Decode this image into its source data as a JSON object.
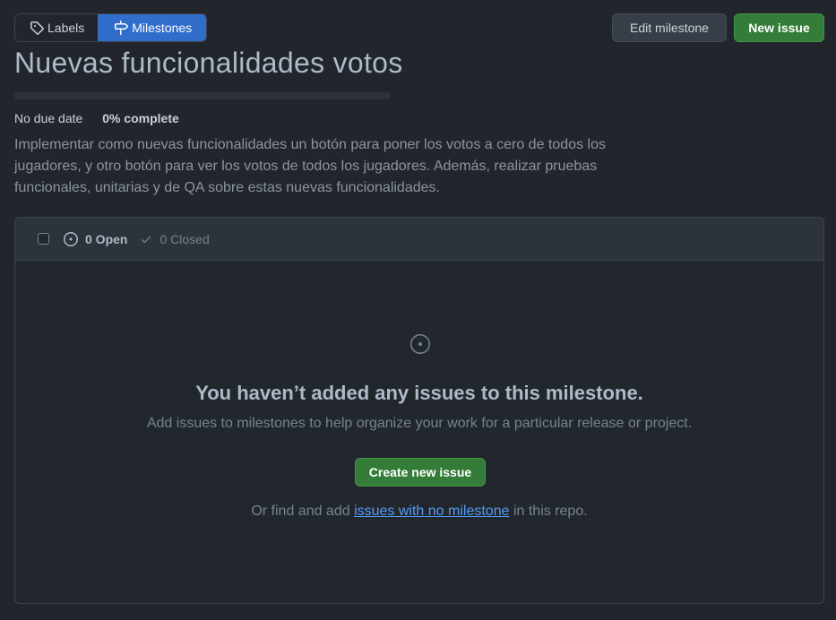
{
  "nav": {
    "labels": "Labels",
    "milestones": "Milestones"
  },
  "actions": {
    "edit_milestone": "Edit milestone",
    "new_issue": "New issue"
  },
  "milestone": {
    "title": "Nuevas funcionalidades votos",
    "due": "No due date",
    "percent_complete": "0% complete",
    "progress": 0,
    "description": "Implementar como nuevas funcionalidades un botón para poner los votos a cero de todos los jugadores, y otro botón para ver los votos de todos los jugadores. Además, realizar pruebas funcionales, unitarias y de QA sobre estas nuevas funcionalidades."
  },
  "issues": {
    "open_label": "0 Open",
    "closed_label": "0 Closed"
  },
  "blankslate": {
    "title": "You haven’t added any issues to this milestone.",
    "text": "Add issues to milestones to help organize your work for a particular release or project.",
    "create_button": "Create new issue",
    "footer_prefix": "Or find and add ",
    "footer_link": "issues with no milestone",
    "footer_suffix": " in this repo."
  },
  "colors": {
    "background": "#22262c",
    "accent_blue": "#316dca",
    "accent_green": "#347d39",
    "link": "#539bf5"
  },
  "icons": {
    "labels": "tag-icon",
    "milestones": "milestone-icon",
    "open": "issue-opened-icon",
    "closed": "check-icon"
  }
}
